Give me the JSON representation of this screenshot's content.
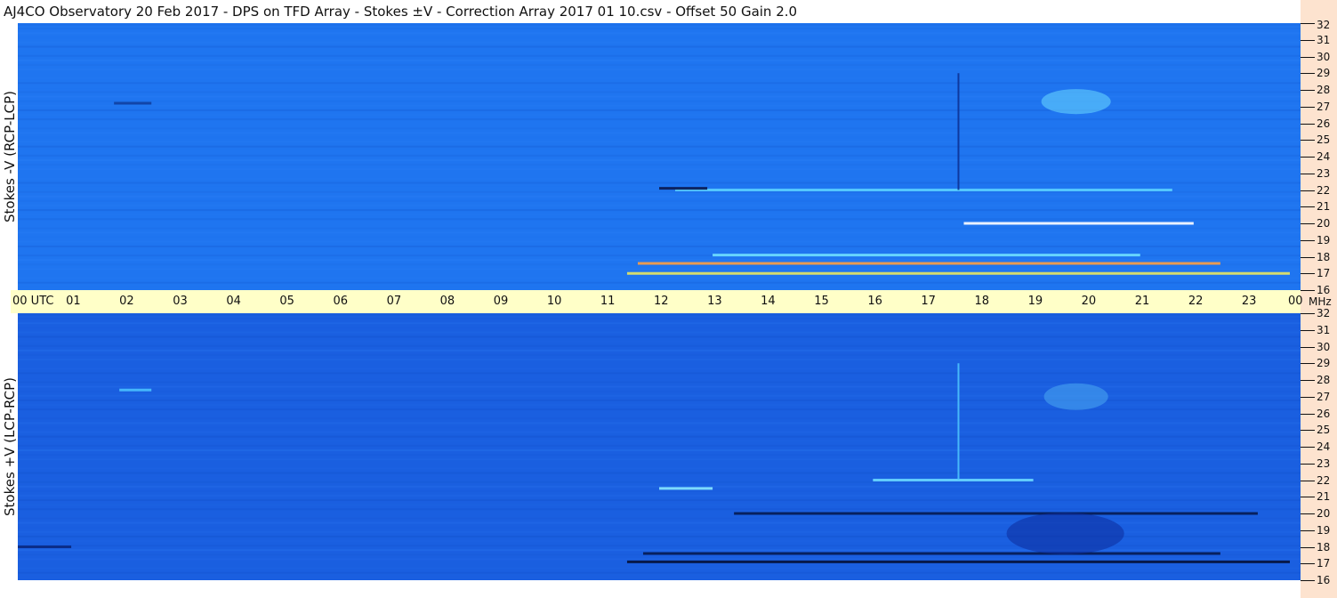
{
  "header": {
    "title": "AJ4CO Observatory  20 Feb 2017  -  DPS on TFD Array  -  Stokes ±V  -  Correction Array 2017 01 10.csv  -  Offset 50  Gain 2.0"
  },
  "chart_data": [
    {
      "type": "heatmap",
      "panel": "top",
      "ylabel": "Stokes -V (RCP-LCP)",
      "x_ticks": [
        "00 UTC",
        "01",
        "02",
        "03",
        "04",
        "05",
        "06",
        "07",
        "08",
        "09",
        "10",
        "11",
        "12",
        "13",
        "14",
        "15",
        "16",
        "17",
        "18",
        "19",
        "20",
        "21",
        "22",
        "23",
        "00"
      ],
      "xlim": [
        0,
        24
      ],
      "x_unit": "UTC hour",
      "y_ticks": [
        16,
        17,
        18,
        19,
        20,
        21,
        22,
        23,
        24,
        25,
        26,
        27,
        28,
        29,
        30,
        31,
        32
      ],
      "y_unit": "MHz",
      "ylim": [
        16,
        32
      ],
      "background_color": "#1f75f0",
      "features": [
        {
          "kind": "bright_band",
          "x_start": 11.4,
          "x_end": 23.8,
          "y": 17.0,
          "color": "#e8e860"
        },
        {
          "kind": "bright_band",
          "x_start": 11.6,
          "x_end": 22.5,
          "y": 17.6,
          "color": "#ffa040"
        },
        {
          "kind": "bright_band",
          "x_start": 13.0,
          "x_end": 21.0,
          "y": 18.1,
          "color": "#70e0ff"
        },
        {
          "kind": "bright_band",
          "x_start": 17.7,
          "x_end": 22.0,
          "y": 20.0,
          "color": "#ffffff"
        },
        {
          "kind": "bright_band",
          "x_start": 12.3,
          "x_end": 21.6,
          "y": 22.0,
          "color": "#5ad0ff"
        },
        {
          "kind": "dark_band",
          "x_start": 12.0,
          "x_end": 12.9,
          "y": 22.1,
          "color": "#0a1a50"
        },
        {
          "kind": "dark_band",
          "x_start": 1.8,
          "x_end": 2.5,
          "y": 27.2,
          "color": "#1040a0"
        },
        {
          "kind": "dark_line",
          "x": 17.6,
          "y_start": 22,
          "y_end": 29,
          "color": "#0c2f90"
        },
        {
          "kind": "bright_patch",
          "x": 19.8,
          "y": 27.3,
          "width": 1.3,
          "height": 1.5,
          "color": "#6ad8ff"
        }
      ]
    },
    {
      "type": "heatmap",
      "panel": "bottom",
      "ylabel": "Stokes +V (LCP-RCP)",
      "x_ticks": [
        "00 UTC",
        "01",
        "02",
        "03",
        "04",
        "05",
        "06",
        "07",
        "08",
        "09",
        "10",
        "11",
        "12",
        "13",
        "14",
        "15",
        "16",
        "17",
        "18",
        "19",
        "20",
        "21",
        "22",
        "23",
        "00"
      ],
      "xlim": [
        0,
        24
      ],
      "x_unit": "UTC hour",
      "y_ticks": [
        16,
        17,
        18,
        19,
        20,
        21,
        22,
        23,
        24,
        25,
        26,
        27,
        28,
        29,
        30,
        31,
        32
      ],
      "y_unit": "MHz",
      "ylim": [
        16,
        32
      ],
      "background_color": "#1a5fe0",
      "features": [
        {
          "kind": "dark_band",
          "x_start": 11.4,
          "x_end": 23.8,
          "y": 17.1,
          "color": "#05123a"
        },
        {
          "kind": "dark_band",
          "x_start": 11.7,
          "x_end": 22.5,
          "y": 17.6,
          "color": "#061a50"
        },
        {
          "kind": "dark_band",
          "x_start": 13.4,
          "x_end": 23.2,
          "y": 20.0,
          "color": "#061a50"
        },
        {
          "kind": "dark_band",
          "x_start": 0.0,
          "x_end": 1.0,
          "y": 18.0,
          "color": "#0a2880"
        },
        {
          "kind": "bright_band",
          "x_start": 16.0,
          "x_end": 19.0,
          "y": 22.0,
          "color": "#6ad8ff"
        },
        {
          "kind": "bright_band",
          "x_start": 12.0,
          "x_end": 13.0,
          "y": 21.5,
          "color": "#8ae8ff"
        },
        {
          "kind": "bright_band",
          "x_start": 1.9,
          "x_end": 2.5,
          "y": 27.4,
          "color": "#4ac0ff"
        },
        {
          "kind": "bright_line",
          "x": 17.6,
          "y_start": 22,
          "y_end": 29,
          "color": "#50c8ff"
        },
        {
          "kind": "bright_patch",
          "x": 19.8,
          "y": 27.0,
          "width": 1.2,
          "height": 1.6,
          "color": "#4aa8f0"
        },
        {
          "kind": "dark_patch",
          "x": 19.6,
          "y": 18.8,
          "width": 2.2,
          "height": 2.5,
          "color": "#0c2c9c"
        }
      ]
    }
  ],
  "axis": {
    "mhz_label": "MHz"
  }
}
